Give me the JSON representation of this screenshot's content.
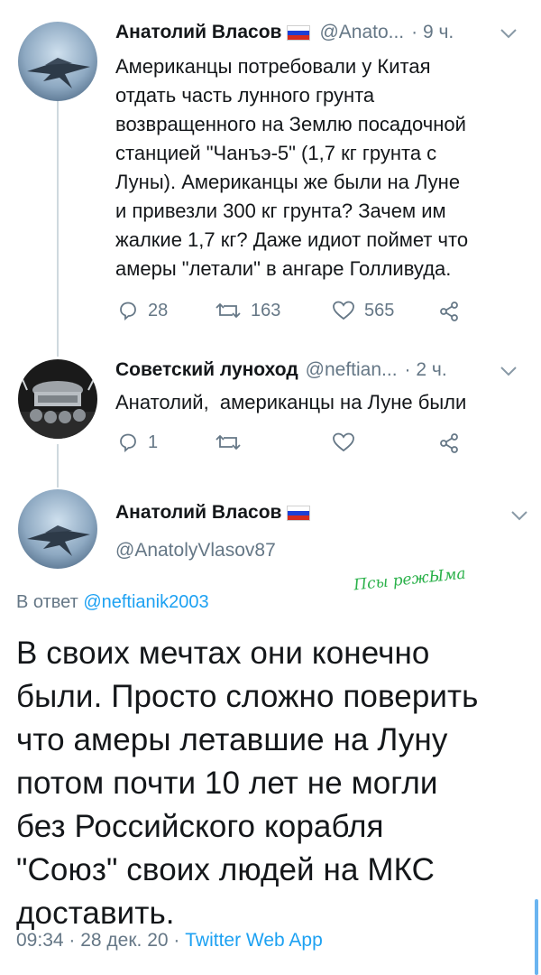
{
  "tweets": [
    {
      "name": "Анатолий Власов",
      "handle": "@Anato...",
      "time": "· 9 ч.",
      "text": "Американцы потребовали у Китая\nотдать часть лунного грунта\nвозвращенного на Землю посадочной\nстанцией \"Чанъэ-5\" (1,7 кг грунта с\nЛуны). Американцы же были на Луне\nи привезли 300 кг грунта? Зачем им\nжалкие 1,7 кг? Даже идиот поймет что\nамеры \"летали\" в ангаре Голливуда.",
      "replies": "28",
      "retweets": "163",
      "likes": "565"
    },
    {
      "name": "Советский луноход",
      "handle": "@neftian...",
      "time": "· 2 ч.",
      "text": "Анатолий,  американцы на Луне были",
      "replies": "1",
      "retweets": "",
      "likes": ""
    }
  ],
  "main_tweet": {
    "name": "Анатолий Власов",
    "handle": "@AnatolyVlasov87",
    "reply_prefix": "В ответ",
    "reply_handle": "@neftianik2003",
    "text": "В своих мечтах они конечно\nбыли. Просто сложно поверить\nчто амеры летавшие на Луну\nпотом почти 10 лет не могли\nбез Российского корабля\n\"Союз\" своих людей на МКС\nдоставить.",
    "time": "09:34 · 28 дек. 20 ·",
    "app": "Twitter Web App"
  },
  "watermark": "Псы режЫма",
  "icons": [
    "reply-icon",
    "retweet-icon",
    "like-icon",
    "share-icon",
    "caret-down-icon",
    "russian-flag-icon"
  ],
  "colors": {
    "link": "#1da1f2",
    "muted": "#657786",
    "text": "#14171a",
    "watermark": "#2bb14a"
  }
}
